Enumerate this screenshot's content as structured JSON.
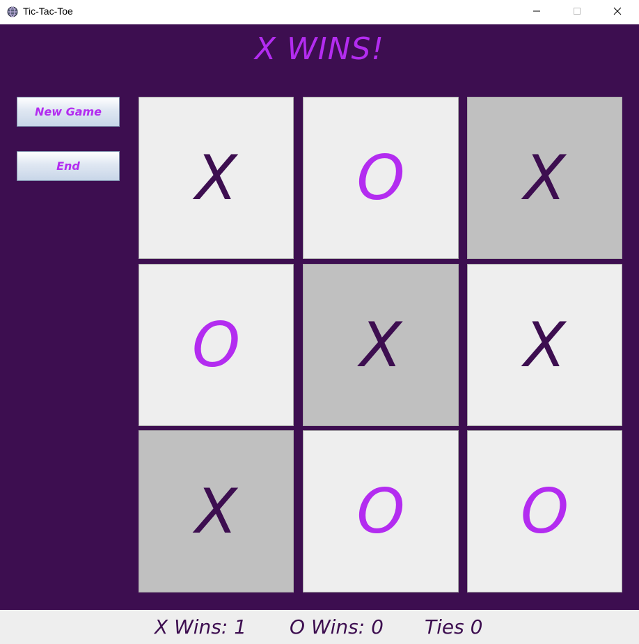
{
  "window": {
    "title": "Tic-Tac-Toe"
  },
  "status": {
    "message": "X WINS!"
  },
  "buttons": {
    "new_game": "New Game",
    "end": "End"
  },
  "board": {
    "cells": [
      {
        "mark": "X",
        "highlighted": false
      },
      {
        "mark": "O",
        "highlighted": false
      },
      {
        "mark": "X",
        "highlighted": true
      },
      {
        "mark": "O",
        "highlighted": false
      },
      {
        "mark": "X",
        "highlighted": true
      },
      {
        "mark": "X",
        "highlighted": false
      },
      {
        "mark": "X",
        "highlighted": true
      },
      {
        "mark": "O",
        "highlighted": false
      },
      {
        "mark": "O",
        "highlighted": false
      }
    ]
  },
  "score": {
    "x_wins": "X Wins: 1",
    "o_wins": "O Wins: 0",
    "ties": "Ties 0"
  },
  "colors": {
    "background": "#3d0e50",
    "accent": "#b32cf0",
    "x_mark": "#3d0e50",
    "o_mark": "#b32cf0",
    "cell": "#eeeeee",
    "cell_highlight": "#c0c0c0"
  },
  "icons": {
    "app": "globe-icon",
    "minimize": "minimize-icon",
    "maximize": "maximize-icon",
    "close": "close-icon"
  }
}
